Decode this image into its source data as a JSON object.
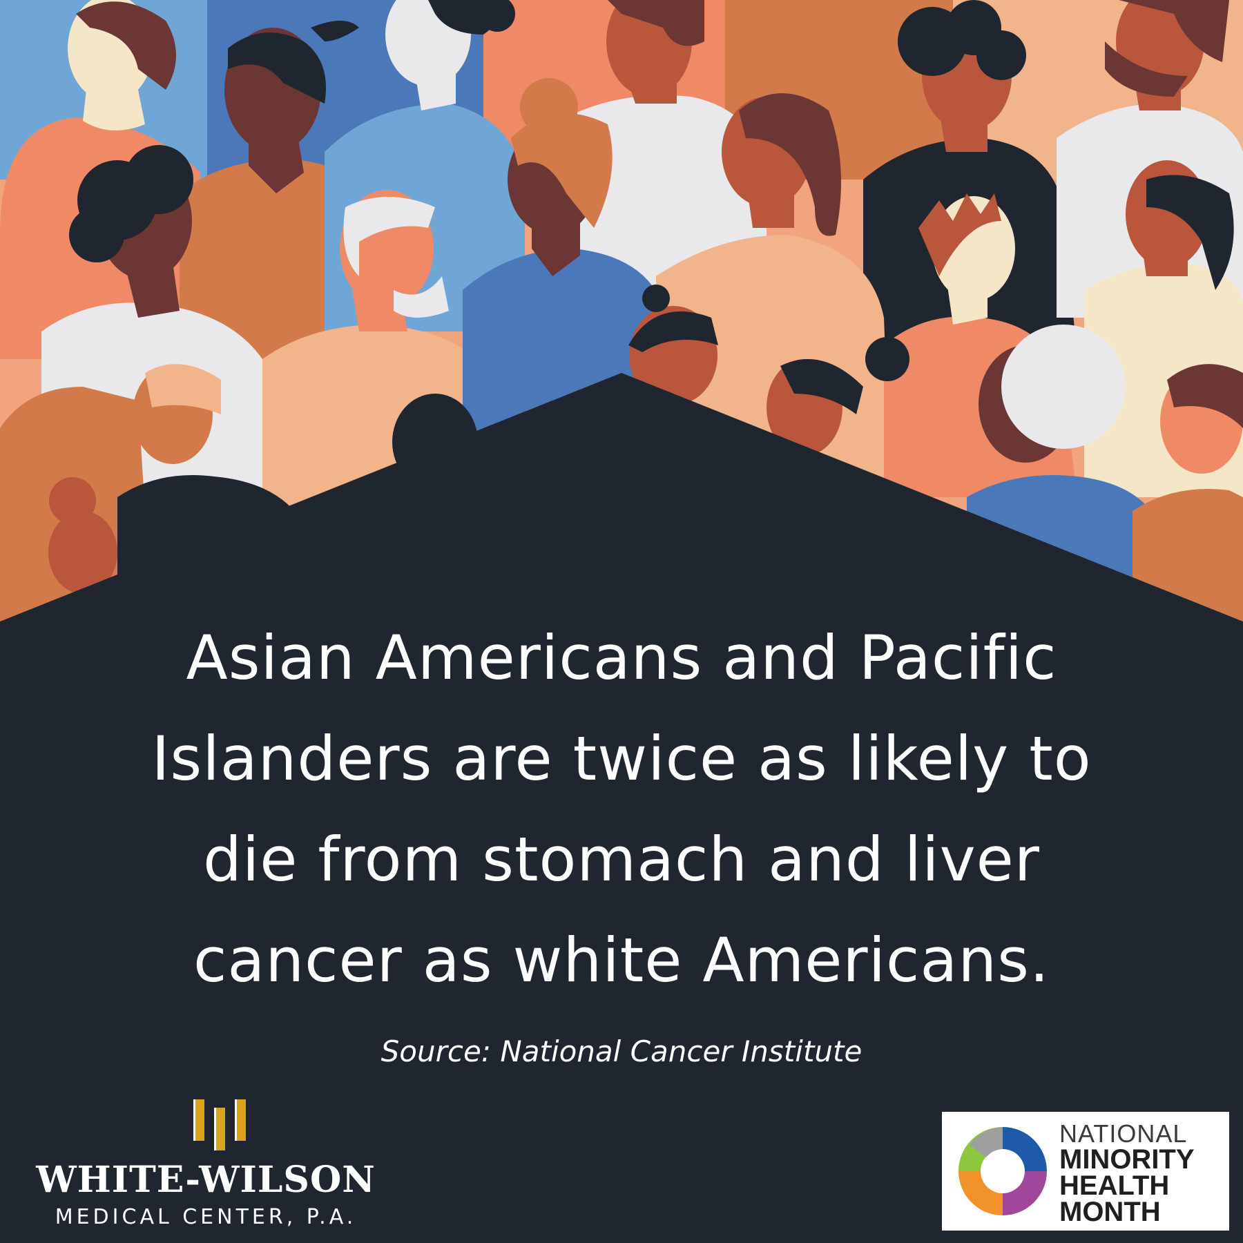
{
  "message": {
    "lines": [
      "Asian Americans and Pacific",
      "Islanders are twice as likely to",
      "die from stomach and liver",
      "cancer as white Americans."
    ]
  },
  "source": "Source: National Cancer Institute",
  "logo_left": {
    "name": "WHITE-WILSON",
    "subtitle": "MEDICAL CENTER, P.A."
  },
  "logo_right": {
    "line1": "NATIONAL",
    "line2": "MINORITY",
    "line3": "HEALTH",
    "line4": "MONTH"
  },
  "colors": {
    "background": "#1f2630",
    "gold": "#d8a21a",
    "skin_light": "#f6e6c8",
    "skin_peach": "#f08a66",
    "skin_tan": "#d27a4a",
    "skin_brown": "#b9563b",
    "skin_dark": "#6b3634",
    "shirt_blue": "#4a78b8",
    "shirt_sky": "#6fa6d6",
    "shirt_white": "#e9e9ec"
  }
}
